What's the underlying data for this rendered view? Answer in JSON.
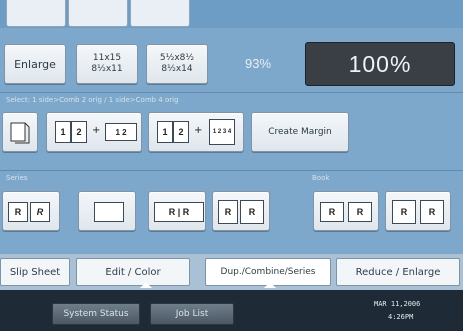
{
  "zoom": {
    "enlarge_label": "Enlarge",
    "preset1_top": "11x15",
    "preset1_bottom": "8½x11",
    "preset2_top": "5½x8½",
    "preset2_bottom": "8½x14",
    "ratio_small": "93%",
    "ratio_main": "100%"
  },
  "sections": {
    "combine_label": "Select:  1 side>Comb 2 orig / 1 side>Comb 4 orig",
    "series_label": "Series",
    "book_label": "Book",
    "create_margin_label": "Create Margin"
  },
  "glyphs": {
    "one": "1",
    "two": "2",
    "twelve": "1 2",
    "quad": "1 2 3 4",
    "r": "R"
  },
  "tabs": {
    "slip_sheet": "Slip Sheet",
    "edit_color": "Edit / Color",
    "dup_combine": "Dup./Combine/Series",
    "reduce_enlarge": "Reduce / Enlarge"
  },
  "status": {
    "system_status": "System Status",
    "job_list": "Job List",
    "date": "MAR 11,2006",
    "time": "4:26PM"
  }
}
